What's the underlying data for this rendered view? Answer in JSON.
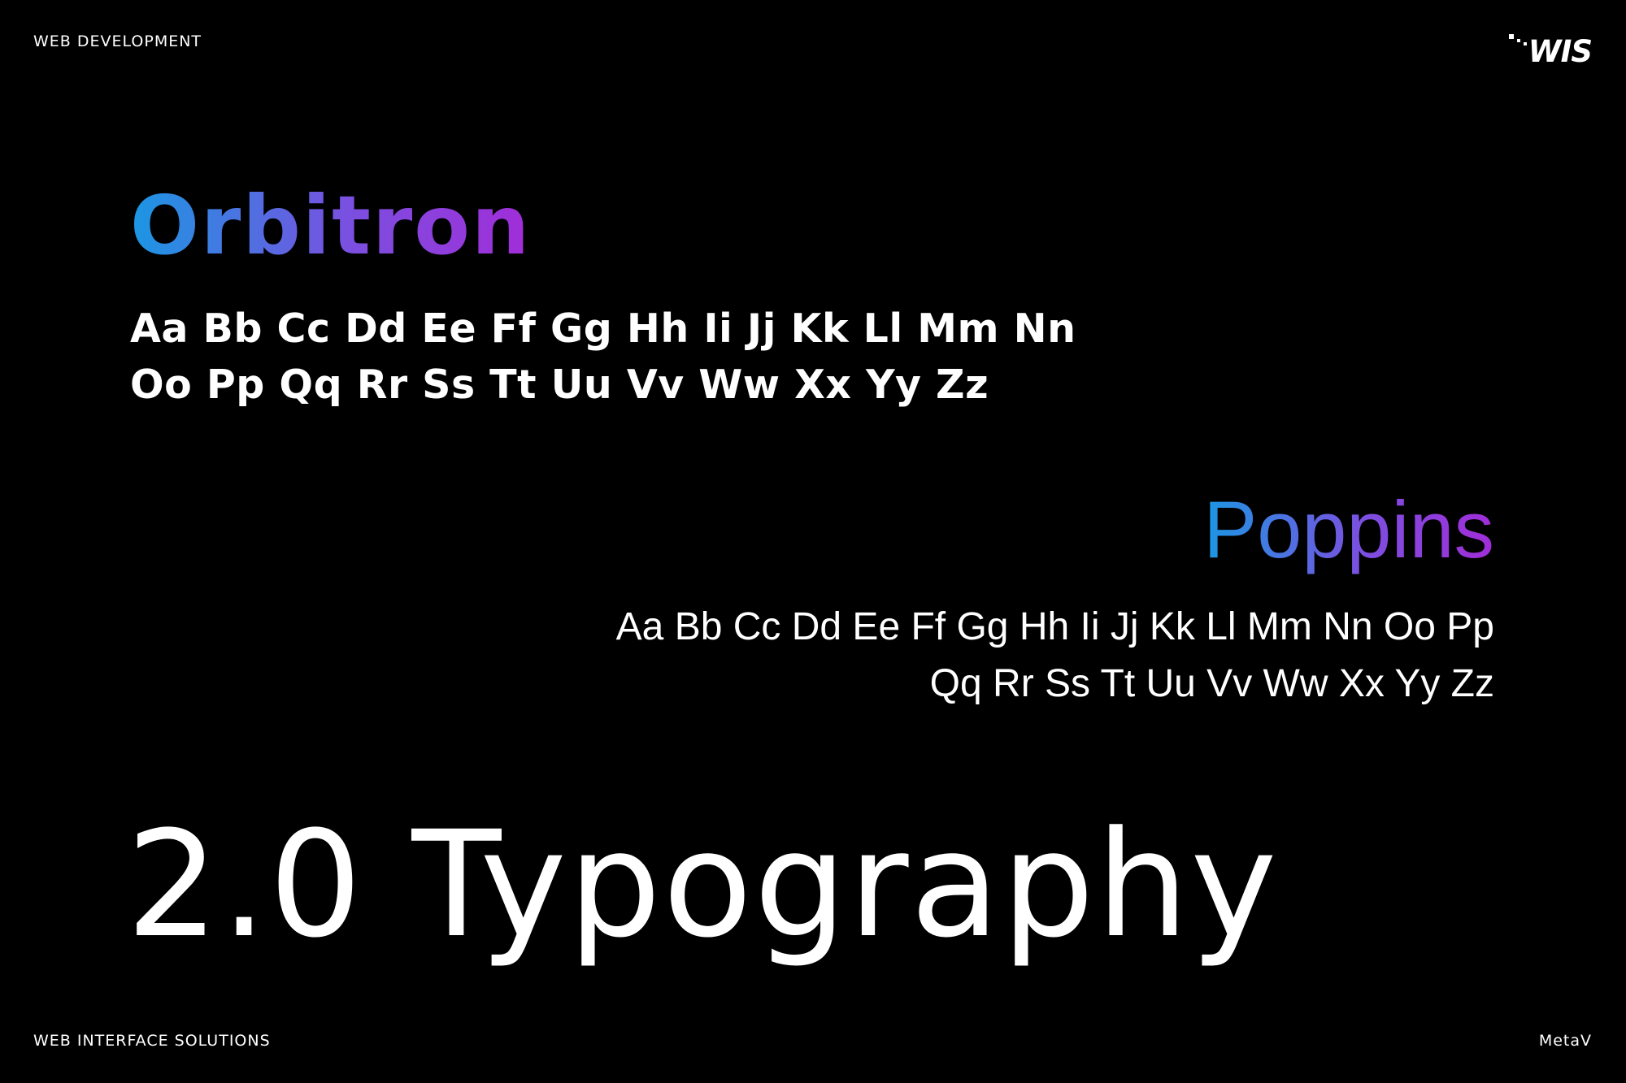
{
  "header": {
    "category": "WEB DEVELOPMENT",
    "logo_text": "WIS"
  },
  "typefaces": [
    {
      "name": "Orbitron",
      "line1": "Aa Bb Cc Dd Ee Ff Gg Hh Ii Jj Kk Ll Mm Nn",
      "line2": "Oo Pp Qq Rr Ss Tt Uu Vv Ww Xx Yy Zz"
    },
    {
      "name": "Poppins",
      "line1": "Aa Bb Cc Dd Ee Ff Gg Hh Ii Jj Kk Ll Mm Nn Oo Pp",
      "line2": "Qq Rr Ss Tt Uu Vv Ww Xx Yy Zz"
    }
  ],
  "headline": "2.0 Typography",
  "footer": {
    "left": "WEB INTERFACE SOLUTIONS",
    "right": "MetaV"
  },
  "colors": {
    "background": "#000000",
    "text": "#ffffff",
    "gradient_start": "#1b97e3",
    "gradient_mid": "#7b4fe0",
    "gradient_end": "#a12dd8"
  }
}
